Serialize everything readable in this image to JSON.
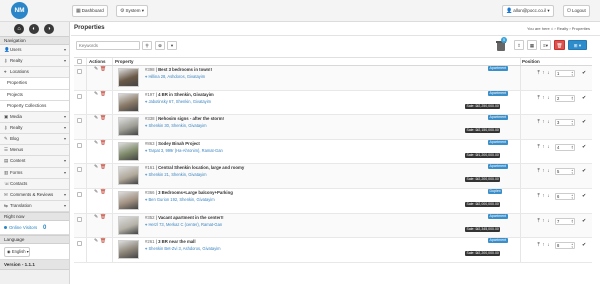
{
  "header": {
    "logo_text": "NM",
    "dashboard_label": "Dashboard",
    "system_label": "System",
    "user_label": "allon@pocc.co.il",
    "logout_label": "Logout"
  },
  "sidebar": {
    "nav_heading": "Navigation",
    "items": [
      {
        "label": "Users",
        "icon": "user-icon",
        "caret": true
      },
      {
        "label": "Realty",
        "icon": "key-icon",
        "caret": true
      },
      {
        "label": "Locations",
        "icon": "pin-icon",
        "caret": false
      },
      {
        "label": "Properties",
        "icon": "",
        "caret": false
      },
      {
        "label": "Projects",
        "icon": "",
        "caret": false
      },
      {
        "label": "Property Collections",
        "icon": "",
        "caret": false
      },
      {
        "label": "Media",
        "icon": "image-icon",
        "caret": true
      },
      {
        "label": "Realty",
        "icon": "key-icon",
        "caret": true
      },
      {
        "label": "Blog",
        "icon": "pencil-icon",
        "caret": true
      },
      {
        "label": "Menus",
        "icon": "list-icon",
        "caret": false
      },
      {
        "label": "Content",
        "icon": "file-icon",
        "caret": true
      },
      {
        "label": "Forms",
        "icon": "form-icon",
        "caret": true
      },
      {
        "label": "Contacts",
        "icon": "contacts-icon",
        "caret": false
      },
      {
        "label": "Comments & Reviews",
        "icon": "comment-icon",
        "caret": true
      },
      {
        "label": "Translation",
        "icon": "translate-icon",
        "caret": true
      }
    ],
    "right_now_heading": "Right now",
    "online_visitors_label": "Online Visitors",
    "online_visitors_count": "0",
    "language_heading": "Language",
    "language_value": "English",
    "version_label": "Version - 1.1.1"
  },
  "main": {
    "title": "Properties",
    "breadcrumb": {
      "prefix": "You are here",
      "items": [
        "Realty",
        "Properties"
      ]
    },
    "keywords_placeholder": "Keywords",
    "trash_count": "5",
    "columns": {
      "actions": "Actions",
      "property": "Property",
      "position": "Position"
    },
    "rows": [
      {
        "id": "#398",
        "title": "Best 3 bedrooms in town!!",
        "address": "Hillina 28, Ashdoros, Givatayim",
        "type": "Apartment",
        "price": "",
        "position": "1",
        "thumb": "#6b5a48"
      },
      {
        "id": "#197",
        "title": "4 BR in Shenkin, Givatayim",
        "address": "Jabotinsky 67, Shenkin, Givatayim",
        "type": "Apartment",
        "price": "Sale: ₪2,250,000.00",
        "position": "2",
        "thumb": "#8a7a68"
      },
      {
        "id": "#338",
        "title": "Nehosim signs - after the storm!",
        "address": "Shenkin 30, Shenkin, Givatayim",
        "type": "Apartment",
        "price": "Sale: ₪2,150,000.00",
        "position": "3",
        "thumb": "#9c9c94"
      },
      {
        "id": "#863",
        "title": "Sodey Binah Project",
        "address": "Tarpat 3, 999r (Ha-Ahronim), Ramat-Gan",
        "type": "Apartment",
        "price": "Sale: ₪1,200,000.00",
        "position": "4",
        "thumb": "#7f8a6a"
      },
      {
        "id": "#161",
        "title": "Central Shenkin location, large and roomy",
        "address": "Shenkin 21, Shenkin, Givatayim",
        "type": "Apartment",
        "price": "Sale: ₪2,200,000.00",
        "position": "5",
        "thumb": "#b0a89a"
      },
      {
        "id": "#366",
        "title": "3 Bedrooms+Large balcony+Parking",
        "address": "Ben Gurion 192, Shenkin, Givatayim",
        "type": "Duplex",
        "price": "Sale: ₪2,000,000.00",
        "position": "6",
        "thumb": "#a09080"
      },
      {
        "id": "#352",
        "title": "Vacant apartment in the center!!",
        "address": "Herzl 73, Merkaz C (center), Ramat-Gan",
        "type": "Apartment",
        "price": "Sale: ₪2,345,000.00",
        "position": "7",
        "thumb": "#b5b2a8"
      },
      {
        "id": "#261",
        "title": "3 BR near the mall",
        "address": "Shenkin Bet-Zvi 3, Ashdoros, Givatayim",
        "type": "Apartment",
        "price": "Sale: ₪2,200,000.00",
        "position": "8",
        "thumb": "#8c8478"
      }
    ]
  }
}
